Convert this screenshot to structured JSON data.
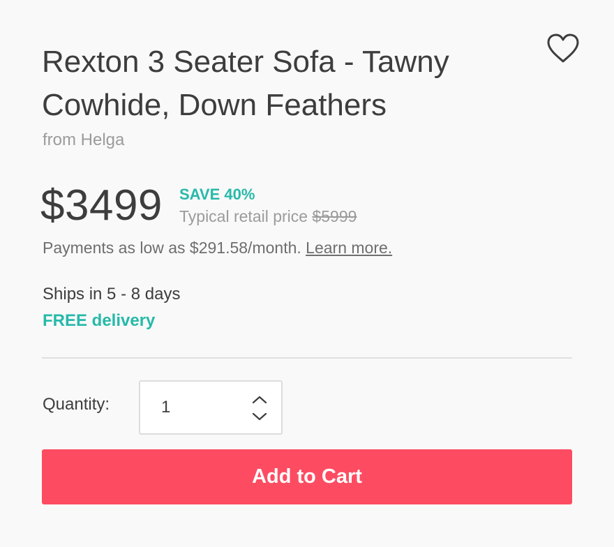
{
  "product": {
    "title": "Rexton 3 Seater Sofa - Tawny Cowhide, Down Feathers",
    "seller_prefix": "from",
    "seller_name": "Helga"
  },
  "pricing": {
    "price": "$3499",
    "save_label": "SAVE 40%",
    "retail_label": "Typical retail price",
    "retail_price": "$5999",
    "payments_text": "Payments as low as $291.58/month.",
    "learn_more": "Learn more."
  },
  "shipping": {
    "ships_text": "Ships in 5 - 8 days",
    "delivery_text": "FREE delivery"
  },
  "quantity": {
    "label": "Quantity:",
    "value": "1"
  },
  "actions": {
    "add_to_cart": "Add to Cart"
  },
  "icons": {
    "favorite": "heart-outline-icon",
    "increment": "chevron-up-icon",
    "decrement": "chevron-down-icon"
  },
  "colors": {
    "accent_teal": "#26b9aa",
    "cart_button": "#fd4c61",
    "text_primary": "#3d3d3d",
    "text_muted": "#9b9b9b"
  }
}
